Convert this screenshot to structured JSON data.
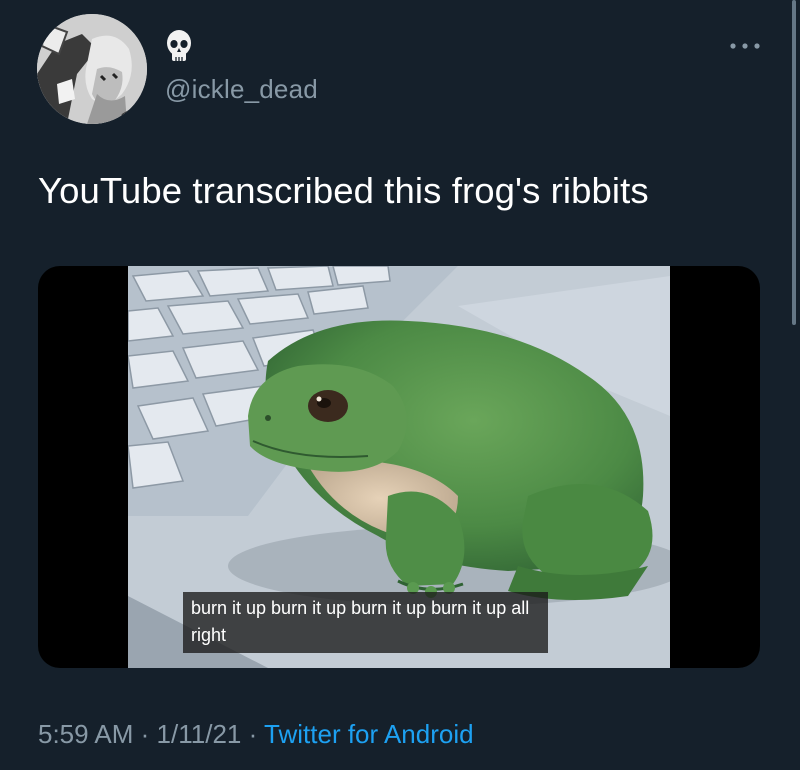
{
  "tweet": {
    "handle": "@ickle_dead",
    "name_emoji": "skull-icon",
    "text": "YouTube transcribed this frog's ribbits",
    "media": {
      "caption": "burn it up burn it up burn it up burn it up all right"
    },
    "time": "5:59 AM",
    "separator": "·",
    "date": "1/11/21",
    "source": "Twitter for Android"
  },
  "icons": {
    "more": "more-options-icon",
    "name_emoji": "skull-icon"
  },
  "colors": {
    "background": "#15202b",
    "text": "#ffffff",
    "secondary": "#8899a6",
    "link": "#1da1f2"
  }
}
